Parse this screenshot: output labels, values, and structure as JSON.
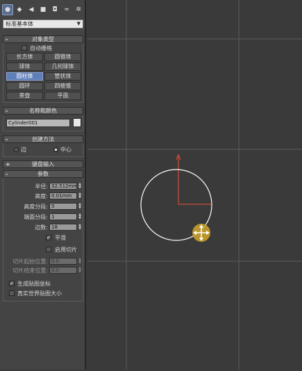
{
  "command_panel": {
    "tabs": [
      {
        "icon": "geometry-icon",
        "active": true
      },
      {
        "icon": "shapes-icon"
      },
      {
        "icon": "lights-icon"
      },
      {
        "icon": "cameras-icon"
      },
      {
        "icon": "helpers-icon"
      },
      {
        "icon": "space-warps-icon"
      },
      {
        "icon": "systems-icon"
      }
    ],
    "category_dropdown": {
      "value": "标准基本体"
    },
    "object_type": {
      "title": "对象类型",
      "autogrid_label": "自动栅格",
      "buttons": [
        "长方体",
        "圆锥体",
        "球体",
        "几何球体",
        "圆柱体",
        "管状体",
        "圆环",
        "四棱锥",
        "茶壶",
        "平面"
      ],
      "active_button": "圆柱体"
    },
    "name_color": {
      "title": "名称和颜色",
      "name_value": "Cylinder001",
      "color_swatch": "#e8e8e8"
    },
    "creation_method": {
      "title": "创建方法",
      "option_edge": "边",
      "option_center": "中心",
      "selected": "中心"
    },
    "keyboard_entry": {
      "title": "键盘输入"
    },
    "parameters": {
      "title": "参数",
      "radius_label": "半径:",
      "radius_value": "32.512mm",
      "height_label": "高度:",
      "height_value": "0.01mm",
      "height_segments_label": "高度分段:",
      "height_segments_value": "5",
      "cap_segments_label": "端面分段:",
      "cap_segments_value": "1",
      "sides_label": "边数:",
      "sides_value": "18",
      "smooth_label": "平滑",
      "smooth_checked": true,
      "slice_on_label": "启用切片",
      "slice_on_checked": false,
      "slice_from_label": "切片起始位置:",
      "slice_from_value": "0.0",
      "slice_to_label": "切片结束位置:",
      "slice_to_value": "0.0",
      "gen_mapping_label": "生成贴图坐标",
      "gen_mapping_checked": true,
      "real_world_label": "真实世界贴图大小",
      "real_world_checked": false
    }
  },
  "viewport": {
    "background": "#3a3a3a",
    "grid_color": "#5c5c5c",
    "circle_color": "#ffffff",
    "gizmo_color": "#b34a3a",
    "cursor_color": "#c8a02a",
    "cursor_icon": "move-cursor-icon"
  }
}
